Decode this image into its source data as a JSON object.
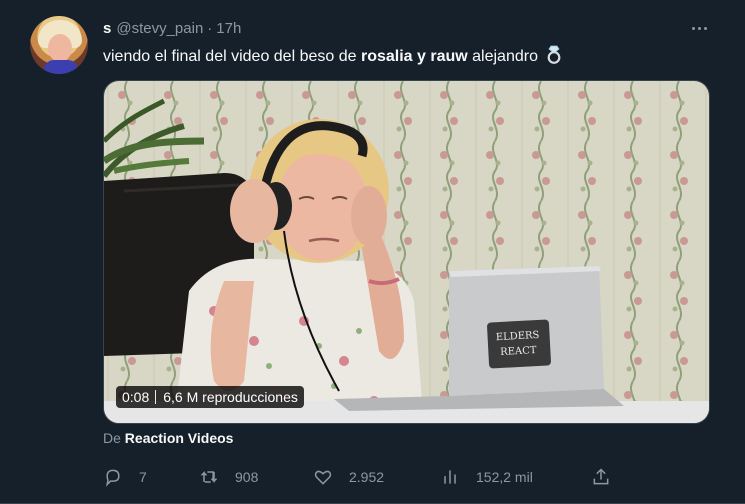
{
  "tweet": {
    "display_name": "s",
    "handle": "@stevy_pain",
    "separator": "·",
    "time": "17h",
    "text_prefix": "viendo el final del video del beso de ",
    "text_bold": "rosalia y rauw",
    "text_suffix": " alejandro",
    "text_emoji": "ring-icon"
  },
  "media": {
    "timestamp": "0:08",
    "views": "6,6 M reproducciones",
    "laptop_sticker": "ELDERS REACT"
  },
  "source": {
    "prefix": "De",
    "name": "Reaction Videos"
  },
  "actions": {
    "replies": "7",
    "retweets": "908",
    "likes": "2.952",
    "views": "152,2 mil"
  },
  "colors": {
    "background": "#15202b",
    "text": "#f7f9f9",
    "muted": "#8b98a5",
    "border": "#38444d"
  }
}
